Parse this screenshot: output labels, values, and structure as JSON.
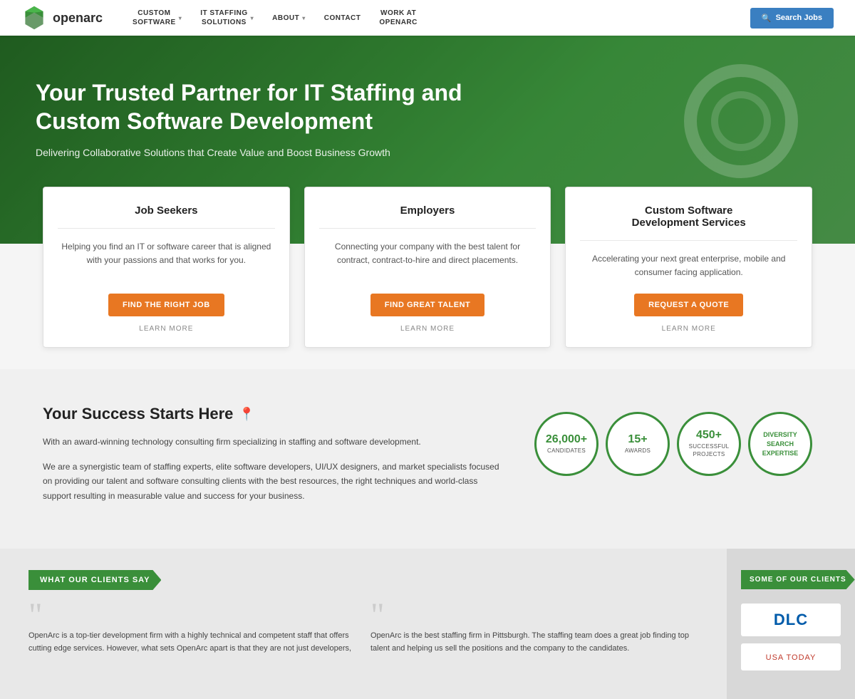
{
  "navbar": {
    "logo_text": "openarc",
    "nav_items": [
      {
        "label": "CUSTOM\nSOFTWARE",
        "has_dropdown": true
      },
      {
        "label": "IT STAFFING\nSOLUTIONS",
        "has_dropdown": true
      },
      {
        "label": "ABOUT",
        "has_dropdown": true
      },
      {
        "label": "CONTACT",
        "has_dropdown": false
      },
      {
        "label": "WORK AT\nOPENARC",
        "has_dropdown": false
      }
    ],
    "search_btn_label": "Search Jobs"
  },
  "hero": {
    "title": "Your Trusted Partner for IT Staffing and Custom Software Development",
    "subtitle": "Delivering Collaborative Solutions that Create Value and Boost Business Growth"
  },
  "cards": [
    {
      "title": "Job Seekers",
      "description": "Helping you find an IT or software career that is aligned with your passions and that works for you.",
      "btn_label": "FIND THE RIGHT JOB",
      "learn_label": "LEARN MORE"
    },
    {
      "title": "Employers",
      "description": "Connecting your company with the best talent for contract, contract-to-hire and direct placements.",
      "btn_label": "FIND GREAT TALENT",
      "learn_label": "LEARN MORE"
    },
    {
      "title": "Custom Software\nDevelopment Services",
      "description": "Accelerating your next great enterprise, mobile and consumer facing application.",
      "btn_label": "REQUEST A QUOTE",
      "learn_label": "LEARN MORE"
    }
  ],
  "success": {
    "title": "Your Success Starts Here",
    "para1": "With an award-winning technology consulting firm specializing in staffing and software development.",
    "para2": "We are a synergistic team of staffing experts, elite software developers, UI/UX designers, and market specialists focused on providing our talent and software consulting clients with the best resources, the right techniques and world-class support resulting in measurable value and success for your business.",
    "stats": [
      {
        "number": "26,000+",
        "label": "CANDIDATES"
      },
      {
        "number": "15+",
        "label": "AWARDS"
      },
      {
        "number": "450+",
        "label": "SUCCESSFUL\nPROJECTS"
      },
      {
        "number": "DIVERSITY\nSEARCH\nEXPERTISE",
        "label": ""
      }
    ]
  },
  "testimonials": {
    "badge_label": "WHAT OUR CLIENTS SAY",
    "items": [
      {
        "text": "OpenArc is a top-tier development firm with a highly technical and competent staff that offers cutting edge services. However, what sets OpenArc apart is that they are not just developers,"
      },
      {
        "text": "OpenArc is the best staffing firm in Pittsburgh. The staffing team does a great job finding top talent and helping us sell the positions and the company to the candidates."
      }
    ]
  },
  "clients": {
    "badge_label": "SOME OF OUR CLIENTS",
    "logos": [
      {
        "text": "DLC",
        "style": "dlc"
      },
      {
        "text": "USA TODAY",
        "style": "usa"
      }
    ]
  }
}
